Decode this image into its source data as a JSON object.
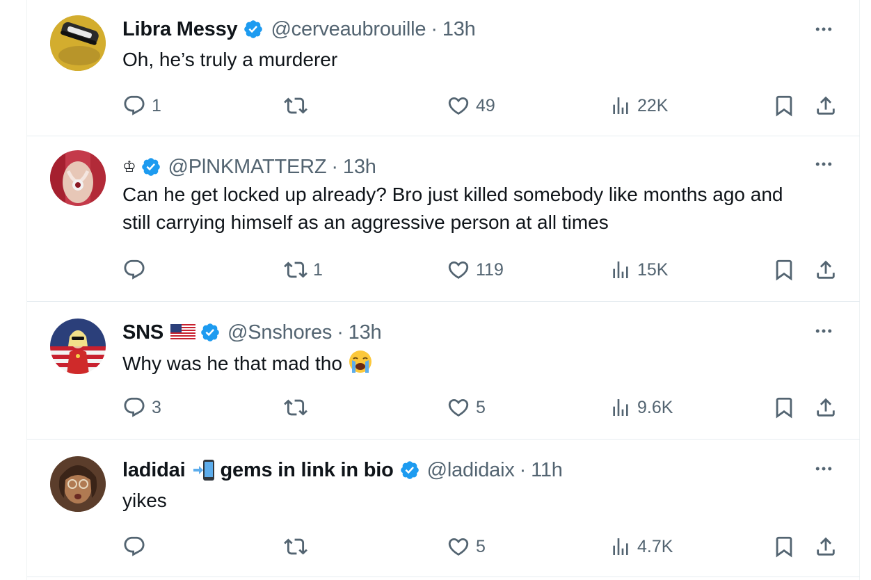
{
  "replies": [
    {
      "display_name": "Libra Messy",
      "handle": "@cerveaubrouille",
      "separator": "·",
      "time": "13h",
      "text": "Oh, he’s truly a murderer",
      "reply_count": "1",
      "retweet_count": "",
      "like_count": "49",
      "view_count": "22K"
    },
    {
      "display_name": "",
      "name_prefix": "♔",
      "handle": "@PlNKMATTERZ",
      "separator": "·",
      "time": "13h",
      "text": "Can he get locked up already? Bro just killed somebody like months ago and still carrying himself as an aggressive person at all times",
      "reply_count": "",
      "retweet_count": "1",
      "like_count": "119",
      "view_count": "15K"
    },
    {
      "display_name": "SNS",
      "handle": "@Snshores",
      "separator": "·",
      "time": "13h",
      "text": "Why was he that mad tho ",
      "reply_count": "3",
      "retweet_count": "",
      "like_count": "5",
      "view_count": "9.6K"
    },
    {
      "display_name": "ladidai",
      "name_suffix": "gems in link in bio",
      "handle": "@ladidaix",
      "separator": "·",
      "time": "11h",
      "text": "yikes",
      "reply_count": "",
      "retweet_count": "",
      "like_count": "5",
      "view_count": "4.7K"
    }
  ],
  "icons": {
    "reply": "reply-icon",
    "retweet": "retweet-icon",
    "like": "heart-icon",
    "views": "views-icon",
    "bookmark": "bookmark-icon",
    "share": "share-icon",
    "more": "more-icon",
    "verified": "verified-badge-icon"
  },
  "colors": {
    "text": "#0f1419",
    "secondary": "#536471",
    "verified": "#1d9bf0",
    "divider": "#e6ecf0"
  }
}
